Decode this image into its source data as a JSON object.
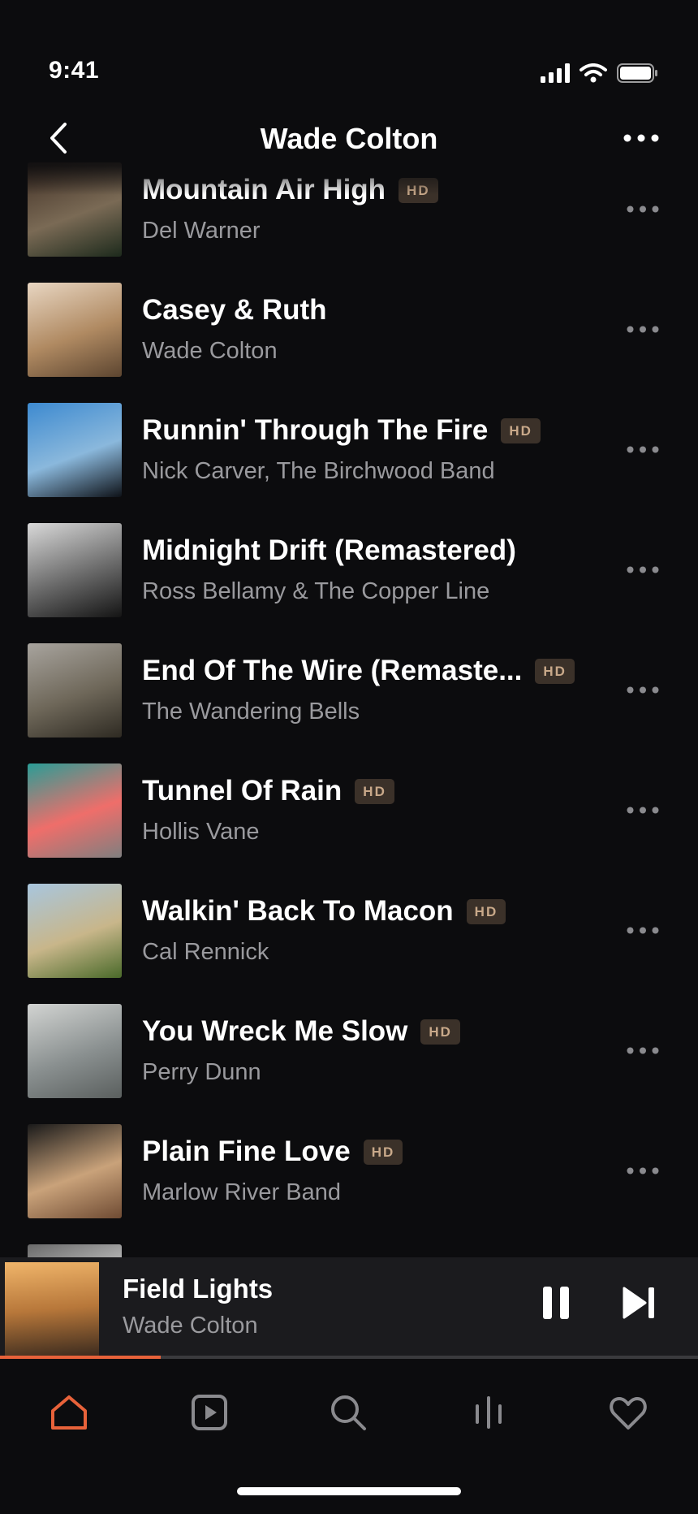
{
  "status_bar": {
    "time": "9:41"
  },
  "header": {
    "title": "Wade Colton"
  },
  "tracks": [
    {
      "title": "Mountain Air High",
      "artist": "Del Warner",
      "hd": "HD",
      "art_colors": [
        "#3f2e24",
        "#7a6a55",
        "#1d2a1c"
      ]
    },
    {
      "title": "Casey & Ruth",
      "artist": "Wade Colton",
      "hd": "",
      "art_colors": [
        "#e8d6c2",
        "#b08a62",
        "#5c4530"
      ]
    },
    {
      "title": "Runnin' Through The Fire",
      "artist": "Nick Carver, The Birchwood Band",
      "hd": "HD",
      "art_colors": [
        "#3d8ad0",
        "#8ab8dc",
        "#0e1218"
      ]
    },
    {
      "title": "Midnight Drift (Remastered)",
      "artist": "Ross Bellamy & The Copper Line",
      "hd": "",
      "art_colors": [
        "#d9d9d9",
        "#6b6b6b",
        "#141414"
      ]
    },
    {
      "title": "End Of The Wire (Remaste...",
      "artist": "The Wandering Bells",
      "hd": "HD",
      "art_colors": [
        "#a8a49e",
        "#6e6759",
        "#2e2a22"
      ]
    },
    {
      "title": "Tunnel Of Rain",
      "artist": "Hollis Vane",
      "hd": "HD",
      "art_colors": [
        "#2a9d96",
        "#ef6e6a",
        "#7f7f7f"
      ]
    },
    {
      "title": "Walkin' Back To Macon",
      "artist": "Cal Rennick",
      "hd": "HD",
      "art_colors": [
        "#a8c6de",
        "#c8b68a",
        "#4a6a2a"
      ]
    },
    {
      "title": "You Wreck Me Slow",
      "artist": "Perry Dunn",
      "hd": "HD",
      "art_colors": [
        "#d2d4d2",
        "#8a9090",
        "#5a5f5e"
      ]
    },
    {
      "title": "Plain Fine Love",
      "artist": "Marlow River Band",
      "hd": "HD",
      "art_colors": [
        "#1a1a1a",
        "#c9a27a",
        "#6f4b33"
      ]
    },
    {
      "title": "",
      "artist": "",
      "hd": "",
      "art_colors": [
        "#6a6a6a",
        "#cfcfcf",
        "#2a2a2a"
      ]
    }
  ],
  "now_playing": {
    "title": "Field Lights",
    "artist": "Wade Colton",
    "progress": 0.23,
    "art_colors": [
      "#f0b56a",
      "#b7773a",
      "#3a2a1e"
    ]
  },
  "tab_bar": {
    "tabs": [
      "home-icon",
      "play-square-icon",
      "search-icon",
      "equalizer-icon",
      "heart-icon"
    ],
    "active_color": "#e8623a",
    "inactive_color": "#8a8a8e"
  }
}
